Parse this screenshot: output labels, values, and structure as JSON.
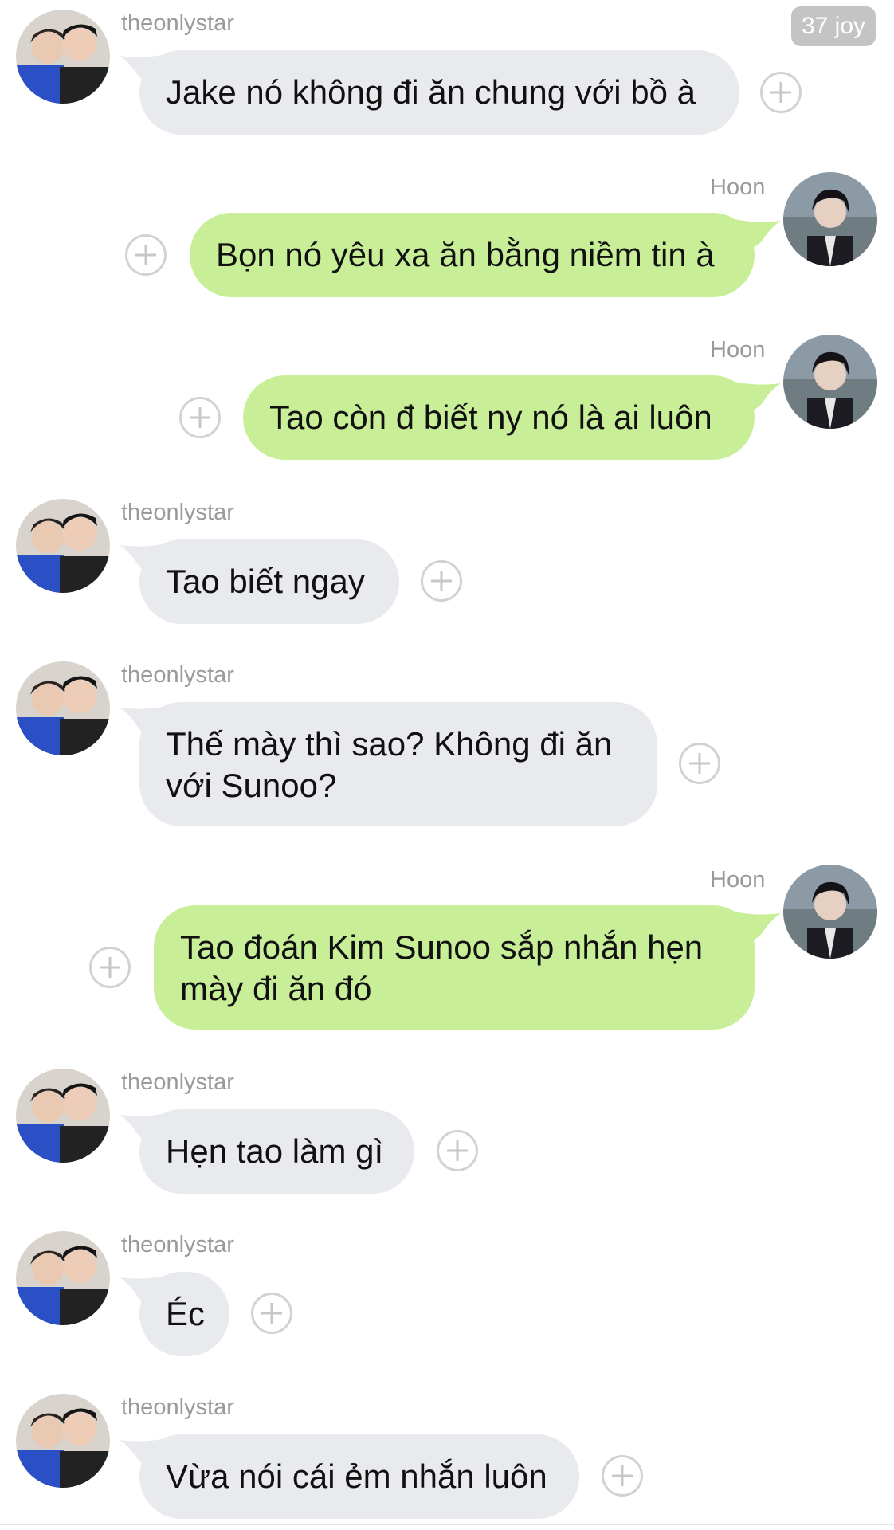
{
  "header": {
    "badge": "37 joy"
  },
  "messages": [
    {
      "sender": "theonlystar",
      "text": "Jake nó không đi ăn chung với bồ à",
      "direction": "incoming"
    },
    {
      "sender": "Hoon",
      "text": "Bọn nó yêu xa ăn bằng niềm tin à",
      "direction": "outgoing"
    },
    {
      "sender": "Hoon",
      "text": "Tao còn đ biết ny nó là ai luôn",
      "direction": "outgoing"
    },
    {
      "sender": "theonlystar",
      "text": "Tao biết ngay",
      "direction": "incoming"
    },
    {
      "sender": "theonlystar",
      "text": "Thế mày thì sao? Không đi ăn\nvới Sunoo?",
      "direction": "incoming"
    },
    {
      "sender": "Hoon",
      "text": "Tao đoán Kim Sunoo sắp nhắn hẹn\nmày đi ăn đó",
      "direction": "outgoing"
    },
    {
      "sender": "theonlystar",
      "text": "Hẹn tao làm gì",
      "direction": "incoming"
    },
    {
      "sender": "theonlystar",
      "text": "Éc",
      "direction": "incoming"
    },
    {
      "sender": "theonlystar",
      "text": "Vừa nói cái ẻm nhắn luôn",
      "direction": "incoming"
    }
  ],
  "colors": {
    "incoming_bubble": "#e8eaed",
    "outgoing_bubble": "#c8ef98",
    "sender_name": "#9a9a9a"
  }
}
